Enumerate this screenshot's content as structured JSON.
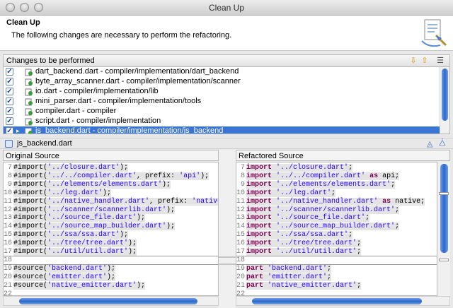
{
  "window": {
    "title": "Clean Up"
  },
  "header": {
    "title": "Clean Up",
    "description": "The following changes are necessary to perform the refactoring."
  },
  "changes": {
    "label": "Changes to be performed",
    "items": [
      {
        "label": "dart_backend.dart - compiler/implementation/dart_backend",
        "checked": true,
        "selected": false
      },
      {
        "label": "byte_array_scanner.dart - compiler/implementation/scanner",
        "checked": true,
        "selected": false
      },
      {
        "label": "io.dart - compiler/implementation/lib",
        "checked": true,
        "selected": false
      },
      {
        "label": "mini_parser.dart - compiler/implementation/tools",
        "checked": true,
        "selected": false
      },
      {
        "label": "compiler.dart - compiler",
        "checked": true,
        "selected": false
      },
      {
        "label": "script.dart - compiler/implementation",
        "checked": true,
        "selected": false
      },
      {
        "label": "js_backend.dart - compiler/implementation/js_backend",
        "checked": true,
        "selected": true
      }
    ]
  },
  "preview": {
    "file": "js_backend.dart"
  },
  "original": {
    "label": "Original Source",
    "lines": [
      {
        "n": "7",
        "code": "#import('../closure.dart');"
      },
      {
        "n": "8",
        "code": "#import('../../compiler.dart', prefix: 'api');"
      },
      {
        "n": "9",
        "code": "#import('../elements/elements.dart');"
      },
      {
        "n": "10",
        "code": "#import('../leg.dart');"
      },
      {
        "n": "11",
        "code": "#import('../native_handler.dart', prefix: 'native');"
      },
      {
        "n": "12",
        "code": "#import('../scanner/scannerlib.dart');"
      },
      {
        "n": "13",
        "code": "#import('../source_file.dart');"
      },
      {
        "n": "14",
        "code": "#import('../source_map_builder.dart');"
      },
      {
        "n": "15",
        "code": "#import('../ssa/ssa.dart');"
      },
      {
        "n": "16",
        "code": "#import('../tree/tree.dart');"
      },
      {
        "n": "17",
        "code": "#import('../util/util.dart');"
      },
      {
        "n": "18",
        "code": ""
      },
      {
        "n": "19",
        "code": "#source('backend.dart');"
      },
      {
        "n": "20",
        "code": "#source('emitter.dart');"
      },
      {
        "n": "21",
        "code": "#source('native_emitter.dart');"
      },
      {
        "n": "22",
        "code": ""
      }
    ]
  },
  "refactored": {
    "label": "Refactored Source",
    "lines": [
      {
        "n": "7",
        "code": "import '../closure.dart';"
      },
      {
        "n": "8",
        "code": "import '../../compiler.dart' as api;"
      },
      {
        "n": "9",
        "code": "import '../elements/elements.dart';"
      },
      {
        "n": "10",
        "code": "import '../leg.dart';"
      },
      {
        "n": "11",
        "code": "import '../native_handler.dart' as native;"
      },
      {
        "n": "12",
        "code": "import '../scanner/scannerlib.dart';"
      },
      {
        "n": "13",
        "code": "import '../source_file.dart';"
      },
      {
        "n": "14",
        "code": "import '../source_map_builder.dart';"
      },
      {
        "n": "15",
        "code": "import '../ssa/ssa.dart';"
      },
      {
        "n": "16",
        "code": "import '../tree/tree.dart';"
      },
      {
        "n": "17",
        "code": "import '../util/util.dart';"
      },
      {
        "n": "18",
        "code": ""
      },
      {
        "n": "19",
        "code": "part 'backend.dart';"
      },
      {
        "n": "20",
        "code": "part 'emitter.dart';"
      },
      {
        "n": "21",
        "code": "part 'native_emitter.dart';"
      },
      {
        "n": "22",
        "code": ""
      }
    ]
  },
  "colors": {
    "selection": "#3875d7",
    "keyword": "#7f0055",
    "string": "#2a00ff"
  }
}
